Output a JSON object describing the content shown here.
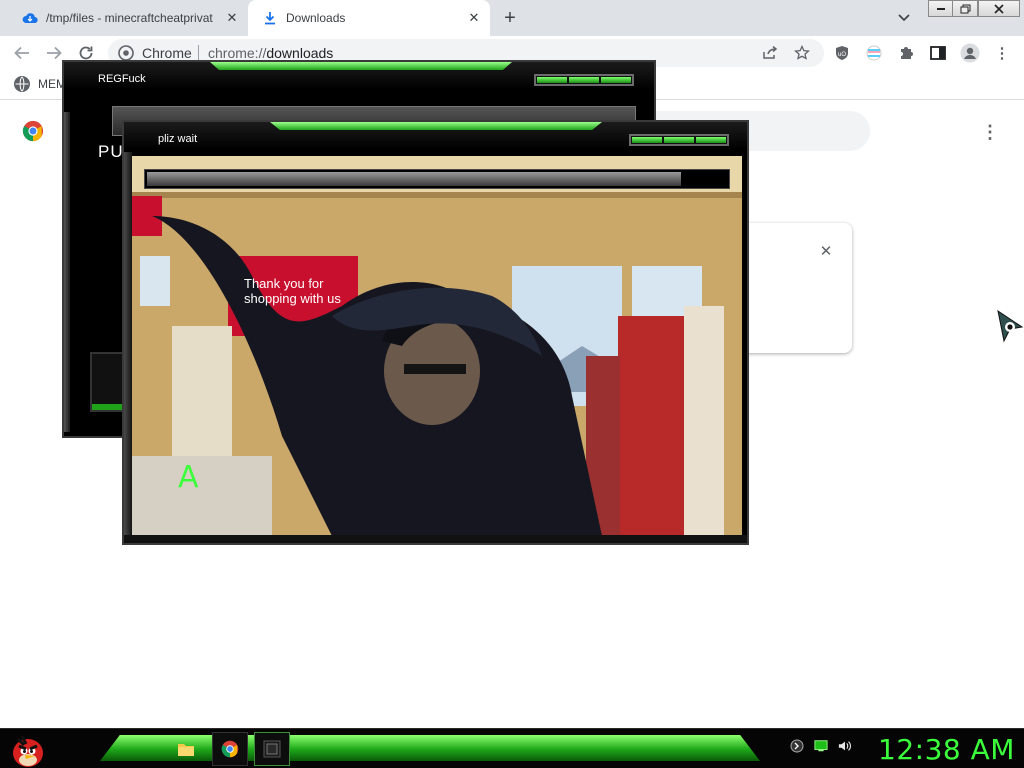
{
  "browser": {
    "tabs": [
      {
        "title": "/tmp/files - minecraftcheatprivat",
        "icon": "cloud-icon",
        "active": false
      },
      {
        "title": "Downloads",
        "icon": "download-icon",
        "active": true
      }
    ],
    "new_tab_icon": "plus-icon",
    "tab_search_icon": "chevron-down-icon",
    "window_controls": [
      "minimize",
      "restore",
      "close"
    ],
    "omnibox": {
      "site_name": "Chrome",
      "url_scheme": "chrome://",
      "url_path": "downloads"
    },
    "toolbar_icons": [
      "share-icon",
      "star-icon",
      "ublock-icon",
      "extension-flag-icon",
      "puzzle-icon",
      "side-panel-icon",
      "profile-icon",
      "kebab-menu-icon"
    ],
    "bookmarks": [
      {
        "label": "MEM",
        "icon": "globe-icon"
      }
    ]
  },
  "downloads_page": {
    "logo": "chrome-logo",
    "menu_icon": "kebab-menu-icon",
    "card_close_icon": "close-icon"
  },
  "malware_windows": {
    "back": {
      "title": "REGFuck",
      "partial_label": "PUS"
    },
    "front": {
      "title": "pliz wait",
      "progress": 0.92,
      "video_caption_sign": "Thank you for shopping with us",
      "video_overlay_letter": "A"
    }
  },
  "taskbar": {
    "start_icon": "angry-bird-icon",
    "apps": [
      "file-explorer-icon",
      "chrome-icon",
      "malware-app-icon"
    ],
    "tray": [
      "shield-tray-icon",
      "network-tray-icon",
      "volume-tray-icon"
    ],
    "clock": "12:38 AM"
  },
  "colors": {
    "accent_green": "#3cff3c",
    "chrome_tabstrip": "#dee1e6",
    "malware_body": "#000000"
  }
}
